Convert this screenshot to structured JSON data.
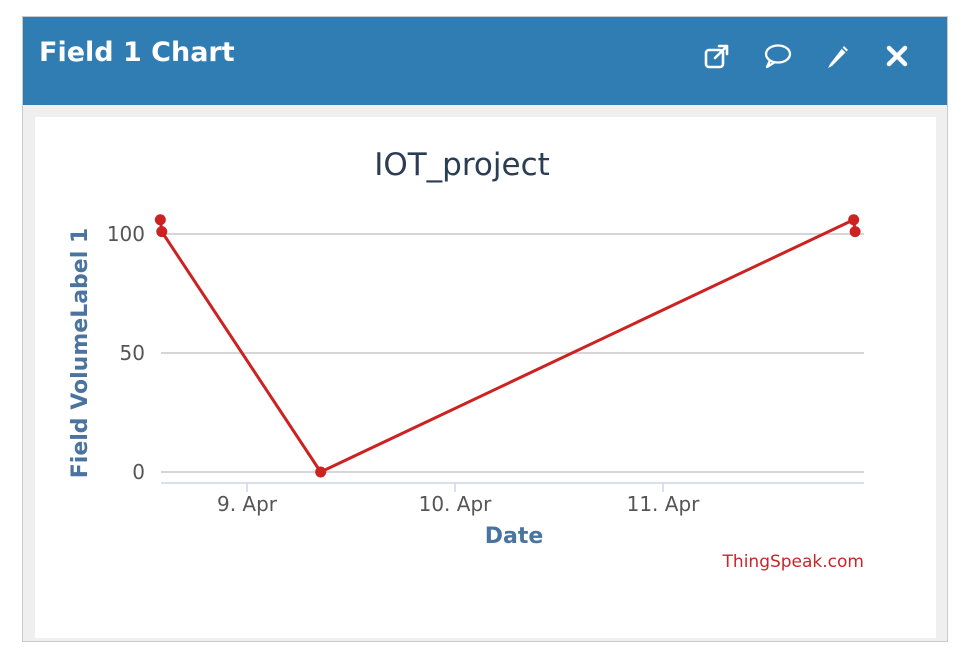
{
  "window": {
    "title": "Field 1 Chart",
    "icons": [
      "external-link-icon",
      "comment-icon",
      "pencil-icon",
      "close-icon"
    ]
  },
  "colors": {
    "header_bg": "#307db3",
    "series": "#cc2222",
    "title": "#2a3d52",
    "axis_label": "#4a73a0",
    "credit": "#c8262a"
  },
  "chart_data": {
    "type": "line",
    "title": "IOT_project",
    "xlabel": "Date",
    "ylabel": "Field VolumeLabel 1",
    "x_ticks": [
      "9. Apr",
      "10. Apr",
      "11. Apr"
    ],
    "y_ticks": [
      0,
      50,
      100
    ],
    "ylim": [
      0,
      100
    ],
    "grid": true,
    "legend": "none",
    "series": [
      {
        "x": [
          "2021-04-08T14:00",
          "2021-04-08T14:10",
          "2021-04-09T08:30",
          "2021-04-11T22:00",
          "2021-04-11T22:10"
        ],
        "values": [
          106,
          101,
          0,
          106,
          101
        ]
      }
    ],
    "credit": "ThingSpeak.com"
  }
}
